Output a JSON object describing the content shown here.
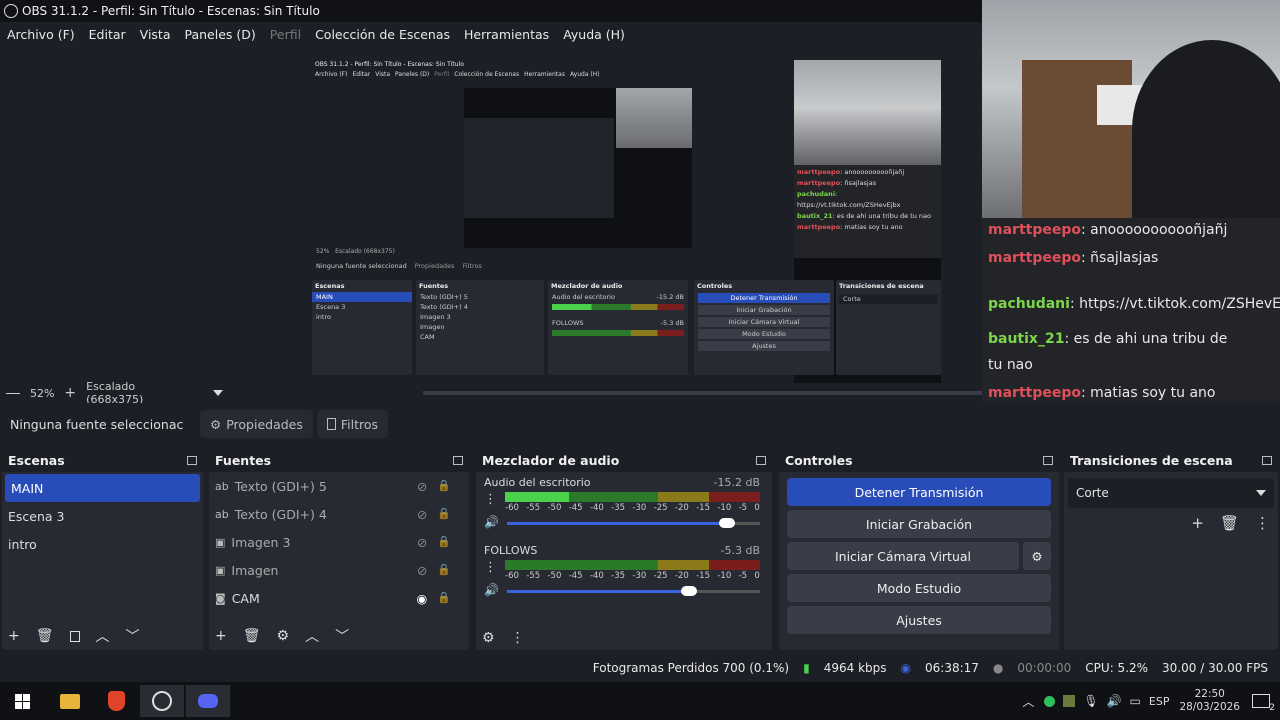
{
  "window": {
    "title": "OBS 31.1.2 - Perfil: Sin Título - Escenas: Sin Título"
  },
  "menu": [
    "Archivo (F)",
    "Editar",
    "Vista",
    "Paneles (D)",
    "Perfil",
    "Colección de Escenas",
    "Herramientas",
    "Ayuda (H)"
  ],
  "nested": {
    "title": "OBS 31.1.2 - Perfil: Sin Título - Escenas: Sin Título",
    "menu": [
      "Archivo (F)",
      "Editar",
      "Vista",
      "Paneles (D)",
      "Perfil",
      "Colección de Escenas",
      "Herramientas",
      "Ayuda (H)"
    ],
    "zoom": "52%",
    "scale": "Escalado (668x375)",
    "no_source": "Ninguna fuente seleccionad",
    "props": "Propiedades",
    "filters": "Filtros",
    "scenes_title": "Escenas",
    "scenes": [
      "MAIN",
      "Escena 3",
      "intro"
    ],
    "sources_title": "Fuentes",
    "sources": [
      "Texto (GDI+) 5",
      "Texto (GDI+) 4",
      "Imagen 3",
      "Imagen",
      "CAM"
    ],
    "mixer_title": "Mezclador de audio",
    "ch1": "Audio del escritorio",
    "ch1db": "-15.2 dB",
    "ch2": "FOLLOWS",
    "ch2db": "-5.3 dB",
    "controls_title": "Controles",
    "controls": [
      "Detener Transmisión",
      "Iniciar Grabación",
      "Iniciar Cámara Virtual",
      "Modo Estudio",
      "Ajustes"
    ],
    "trans_title": "Transiciones de escena",
    "trans": "Corte",
    "chat": [
      {
        "user": "marttpeepo",
        "msg": ": anoooooooooñjañj"
      },
      {
        "user": "marttpeepo",
        "msg": ": ñsajlasjas"
      },
      {
        "user": "pachudani",
        "msg": ": https://vt.tiktok.com/ZSHevEjbx"
      },
      {
        "user": "bautix_21",
        "msg": ": es de ahi una tribu de tu nao"
      },
      {
        "user": "marttpeepo",
        "msg": ": matias soy tu ano"
      }
    ]
  },
  "preview": {
    "zoom": "52%",
    "scale": "Escalado (668x375)"
  },
  "chat": [
    {
      "user": "marttpeepo",
      "msg": ": anooooooooooñjañj",
      "color": "#e0505a"
    },
    {
      "user": "marttpeepo",
      "msg": ": ñsajlasjas",
      "color": "#e0505a"
    },
    {
      "user": "pachudani",
      "msg": ": https://vt.tiktok.com/ZSHevEjbx",
      "color": "#7cd64a"
    },
    {
      "user": "bautix_21",
      "msg": ": es de ahi una tribu de",
      "color": "#7cd64a"
    },
    {
      "cont": "tu nao"
    },
    {
      "user": "marttpeepo",
      "msg": ": matias soy tu ano",
      "color": "#e0505a"
    }
  ],
  "source_toolbar": {
    "no_source": "Ninguna fuente seleccionac",
    "properties": "Propiedades",
    "filters": "Filtros"
  },
  "scenes": {
    "title": "Escenas",
    "items": [
      "MAIN",
      "Escena 3",
      "intro"
    ],
    "selected": 0
  },
  "sources": {
    "title": "Fuentes",
    "items": [
      {
        "label": "Texto (GDI+) 5",
        "icon": "text-icon",
        "visible": false
      },
      {
        "label": "Texto (GDI+) 4",
        "icon": "text-icon",
        "visible": false
      },
      {
        "label": "Imagen 3",
        "icon": "image-icon",
        "visible": false
      },
      {
        "label": "Imagen",
        "icon": "image-icon",
        "visible": false
      },
      {
        "label": "CAM",
        "icon": "camera-icon",
        "visible": true
      }
    ]
  },
  "mixer": {
    "title": "Mezclador de audio",
    "ticks": [
      "-60",
      "-55",
      "-50",
      "-45",
      "-40",
      "-35",
      "-30",
      "-25",
      "-20",
      "-15",
      "-10",
      "-5",
      "0"
    ],
    "channels": [
      {
        "name": "Audio del escritorio",
        "db": "-15.2 dB",
        "level": 0.25,
        "volume": 0.9
      },
      {
        "name": "FOLLOWS",
        "db": "-5.3 dB",
        "level": 0.0,
        "volume": 0.75
      }
    ]
  },
  "controls": {
    "title": "Controles",
    "stop_stream": "Detener Transmisión",
    "start_record": "Iniciar Grabación",
    "virtual_cam": "Iniciar Cámara Virtual",
    "studio_mode": "Modo Estudio",
    "settings": "Ajustes"
  },
  "transitions": {
    "title": "Transiciones de escena",
    "selected": "Corte"
  },
  "status": {
    "dropped": "Fotogramas Perdidos 700 (0.1%)",
    "bitrate": "4964 kbps",
    "stream_time": "06:38:17",
    "rec_time": "00:00:00",
    "cpu": "CPU: 5.2%",
    "fps": "30.00 / 30.00 FPS"
  },
  "taskbar": {
    "lang": "ESP",
    "time": "22:50",
    "date": "28/03/2026",
    "notif": "2"
  },
  "colors": {
    "accent": "#284cb8",
    "panel": "#272a33",
    "bg": "#1d1f26"
  }
}
